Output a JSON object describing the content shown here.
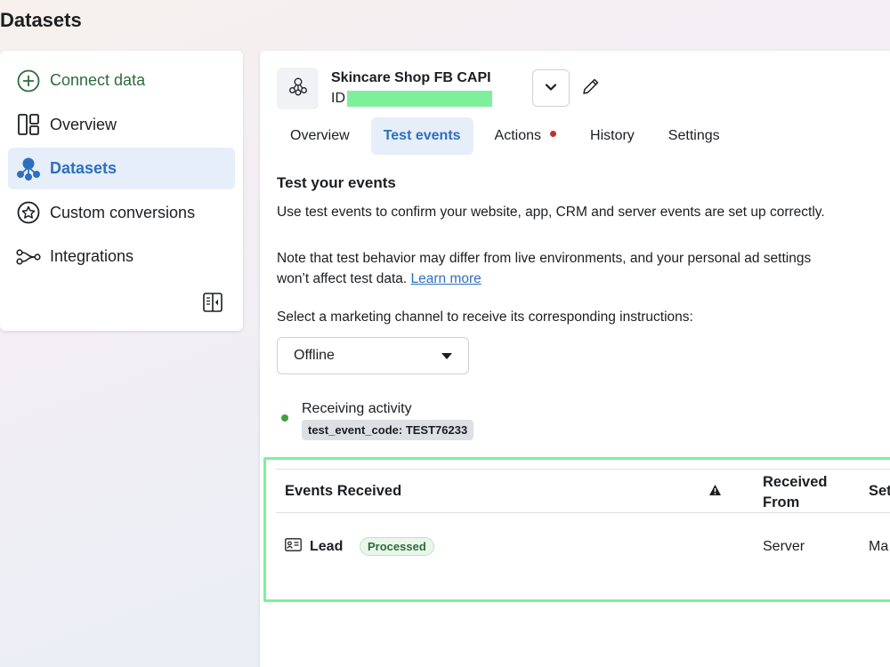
{
  "page": {
    "title": "Datasets"
  },
  "sidebar": {
    "items": [
      {
        "label": "Connect data",
        "icon": "plus-circle-icon"
      },
      {
        "label": "Overview",
        "icon": "layout-icon"
      },
      {
        "label": "Datasets",
        "icon": "dataset-icon"
      },
      {
        "label": "Custom conversions",
        "icon": "star-circle-icon"
      },
      {
        "label": "Integrations",
        "icon": "integrations-icon"
      }
    ],
    "active_item": "Datasets"
  },
  "dataset": {
    "name": "Skincare Shop FB CAPI",
    "id_label": "ID"
  },
  "tabs": [
    {
      "label": "Overview"
    },
    {
      "label": "Test events"
    },
    {
      "label": "Actions"
    },
    {
      "label": "History"
    },
    {
      "label": "Settings"
    }
  ],
  "active_tab": "Test events",
  "test_events": {
    "title": "Test your events",
    "intro": "Use test events to confirm your website, app, CRM and server events are set up correctly.",
    "note_line1": "Note that test behavior may differ from live environments, and your personal ad settings",
    "note_line2": "won’t affect test data.",
    "learn_more": "Learn more",
    "channel_prompt": "Select a marketing channel to receive its corresponding instructions:",
    "channel_selected": "Offline",
    "status": "Receiving activity",
    "test_code": "test_event_code: TEST76233"
  },
  "events_table": {
    "headers": {
      "events": "Events Received",
      "received_from_1": "Received",
      "received_from_2": "From",
      "setup": "Set"
    },
    "rows": [
      {
        "event": "Lead",
        "status": "Processed",
        "received_from": "Server",
        "setup": "Ma"
      }
    ]
  },
  "colors": {
    "accent": "#2d6fc0",
    "highlight": "#7ef09c",
    "status_ok": "#42a042",
    "alert_dot": "#c0312c"
  }
}
